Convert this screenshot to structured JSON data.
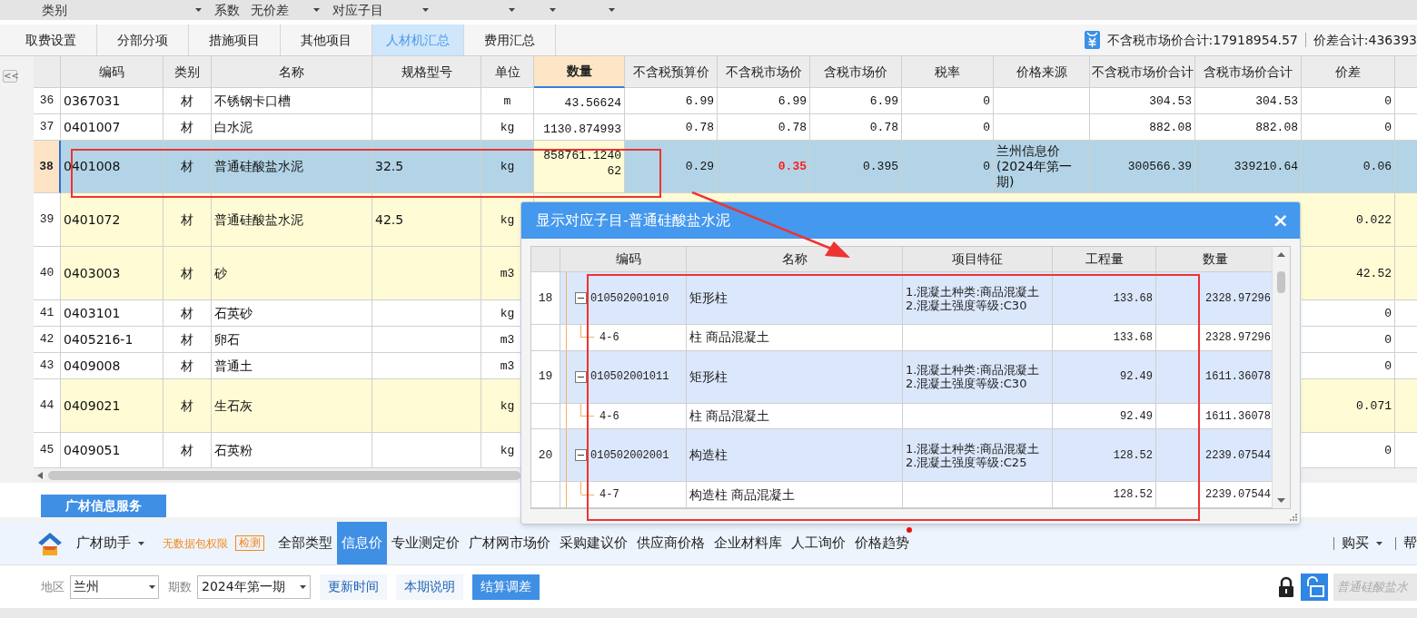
{
  "filters": [
    {
      "kind": "dropdown",
      "value": "类别"
    },
    {
      "kind": "label",
      "text": "系数"
    },
    {
      "kind": "dropdown",
      "value": "无价差"
    },
    {
      "kind": "dropdown",
      "value": "对应子目"
    },
    {
      "kind": "dropdown"
    },
    {
      "kind": "dropdown"
    },
    {
      "kind": "dropdown"
    }
  ],
  "tabs": [
    {
      "label": "取费设置",
      "selected": false
    },
    {
      "label": "分部分项",
      "selected": false
    },
    {
      "label": "措施项目",
      "selected": false
    },
    {
      "label": "其他项目",
      "selected": false
    },
    {
      "label": "人材机汇总",
      "selected": true
    },
    {
      "label": "费用汇总",
      "selected": false
    }
  ],
  "totals": [
    "不含税市场价合计:17918954.57",
    "价差合计:436393"
  ],
  "collapse_button": "<<",
  "table": {
    "columns": [
      {
        "label": "编码",
        "selected": false
      },
      {
        "label": "类别",
        "selected": false
      },
      {
        "label": "名称",
        "selected": false
      },
      {
        "label": "规格型号",
        "selected": false
      },
      {
        "label": "单位",
        "selected": false
      },
      {
        "label": "数量",
        "selected": true
      },
      {
        "label": "不含税预算价",
        "selected": false
      },
      {
        "label": "不含税市场价",
        "selected": false
      },
      {
        "label": "含税市场价",
        "selected": false
      },
      {
        "label": "税率",
        "selected": false
      },
      {
        "label": "价格来源",
        "selected": false
      },
      {
        "label": "不含税市场价合计",
        "selected": false
      },
      {
        "label": "含税市场价合计",
        "selected": false
      },
      {
        "label": "价差",
        "selected": false
      }
    ],
    "rows": [
      {
        "index": "36",
        "selected": false,
        "highlighted": false,
        "market_changed": false,
        "code": "0367031",
        "type": "材",
        "name": "不锈钢卡口槽",
        "unit": "m",
        "qty": "43.56624",
        "budget": "6.99",
        "market": "6.99",
        "market_tax": "6.99",
        "tax_rate": "0",
        "market_total": "304.53",
        "tax_total": "304.53",
        "diff": "0"
      },
      {
        "index": "37",
        "selected": false,
        "highlighted": false,
        "market_changed": false,
        "code": "0401007",
        "type": "材",
        "name": "白水泥",
        "unit": "kg",
        "qty": "1130.874993",
        "budget": "0.78",
        "market": "0.78",
        "market_tax": "0.78",
        "tax_rate": "0",
        "market_total": "882.08",
        "tax_total": "882.08",
        "diff": "0"
      },
      {
        "index": "38",
        "selected": true,
        "highlighted": false,
        "market_changed": true,
        "code": "0401008",
        "type": "材",
        "name": "普通硅酸盐水泥",
        "spec": "32.5",
        "unit": "kg",
        "qty": "858761.124062",
        "budget": "0.29",
        "market": "0.35",
        "market_tax": "0.395",
        "tax_rate": "0",
        "source": "兰州信息价(2024年第一期)",
        "market_total": "300566.39",
        "tax_total": "339210.64",
        "diff": "0.06"
      },
      {
        "index": "39",
        "selected": false,
        "highlighted": true,
        "code": "0401072",
        "type": "材",
        "name": "普通硅酸盐水泥",
        "spec": "42.5",
        "unit": "kg",
        "diff": "0.022"
      },
      {
        "index": "40",
        "selected": false,
        "highlighted": true,
        "code": "0403003",
        "type": "材",
        "name": "砂",
        "unit": "m3",
        "diff": "42.52"
      },
      {
        "index": "41",
        "selected": false,
        "highlighted": false,
        "code": "0403101",
        "type": "材",
        "name": "石英砂",
        "unit": "kg",
        "diff": "0"
      },
      {
        "index": "42",
        "selected": false,
        "highlighted": false,
        "code": "0405216-1",
        "type": "材",
        "name": "卵石",
        "unit": "m3",
        "diff": "0"
      },
      {
        "index": "43",
        "selected": false,
        "highlighted": false,
        "code": "0409008",
        "type": "材",
        "name": "普通土",
        "unit": "m3",
        "diff": "0"
      },
      {
        "index": "44",
        "selected": false,
        "highlighted": true,
        "code": "0409021",
        "type": "材",
        "name": "生石灰",
        "unit": "kg",
        "diff": "0.071"
      },
      {
        "index": "45",
        "selected": false,
        "highlighted": false,
        "code": "0409051",
        "type": "材",
        "name": "石英粉",
        "unit": "kg",
        "diff": "0"
      }
    ]
  },
  "popup": {
    "title": "显示对应子目-普通硅酸盐水泥",
    "close": "×",
    "columns": [
      "编码",
      "名称",
      "项目特征",
      "工程量",
      "数量"
    ],
    "rows": [
      {
        "index": "18",
        "expanded": true,
        "code": "010502001010",
        "name": "矩形柱",
        "feature": [
          "1.混凝土种类:商品混凝土",
          "2.混凝土强度等级:C30"
        ],
        "quantity": "133.68",
        "amount": "2328.97296",
        "children": [
          {
            "code": "4-6",
            "name": "柱 商品混凝土",
            "quantity": "133.68",
            "amount": "2328.97296"
          }
        ]
      },
      {
        "index": "19",
        "expanded": true,
        "code": "010502001011",
        "name": "矩形柱",
        "feature": [
          "1.混凝土种类:商品混凝土",
          "2.混凝土强度等级:C30"
        ],
        "quantity": "92.49",
        "amount": "1611.36078",
        "children": [
          {
            "code": "4-6",
            "name": "柱 商品混凝土",
            "quantity": "92.49",
            "amount": "1611.36078"
          }
        ]
      },
      {
        "index": "20",
        "expanded": true,
        "code": "010502002001",
        "name": "构造柱",
        "feature": [
          "1.混凝土种类:商品混凝土",
          "2.混凝土强度等级:C25"
        ],
        "quantity": "128.52",
        "amount": "2239.07544",
        "children": [
          {
            "code": "4-7",
            "name": "构造柱 商品混凝土",
            "quantity": "128.52",
            "amount": "2239.07544"
          }
        ]
      }
    ]
  },
  "service": {
    "tab": "广材信息服务",
    "assistant": "广材助手",
    "permission": "无数据包权限",
    "check": "检测",
    "menu": [
      {
        "label": "全部类型",
        "selected": false,
        "notify": false
      },
      {
        "label": "信息价",
        "selected": true,
        "notify": false
      },
      {
        "label": "专业测定价",
        "selected": false,
        "notify": false
      },
      {
        "label": "广材网市场价",
        "selected": false,
        "notify": false
      },
      {
        "label": "采购建议价",
        "selected": false,
        "notify": false
      },
      {
        "label": "供应商价格",
        "selected": false,
        "notify": false
      },
      {
        "label": "企业材料库",
        "selected": false,
        "notify": false
      },
      {
        "label": "人工询价",
        "selected": false,
        "notify": false
      },
      {
        "label": "价格趋势",
        "selected": false,
        "notify": true
      }
    ],
    "right_menu": [
      "购买",
      "帮"
    ],
    "region_label": "地区",
    "region": "兰州",
    "period_label": "期数",
    "period": "2024年第一期",
    "buttons": [
      {
        "label": "更新时间",
        "primary": false
      },
      {
        "label": "本期说明",
        "primary": false
      },
      {
        "label": "结算调差",
        "primary": true
      }
    ],
    "search_placeholder": "普通硅酸盐水"
  }
}
